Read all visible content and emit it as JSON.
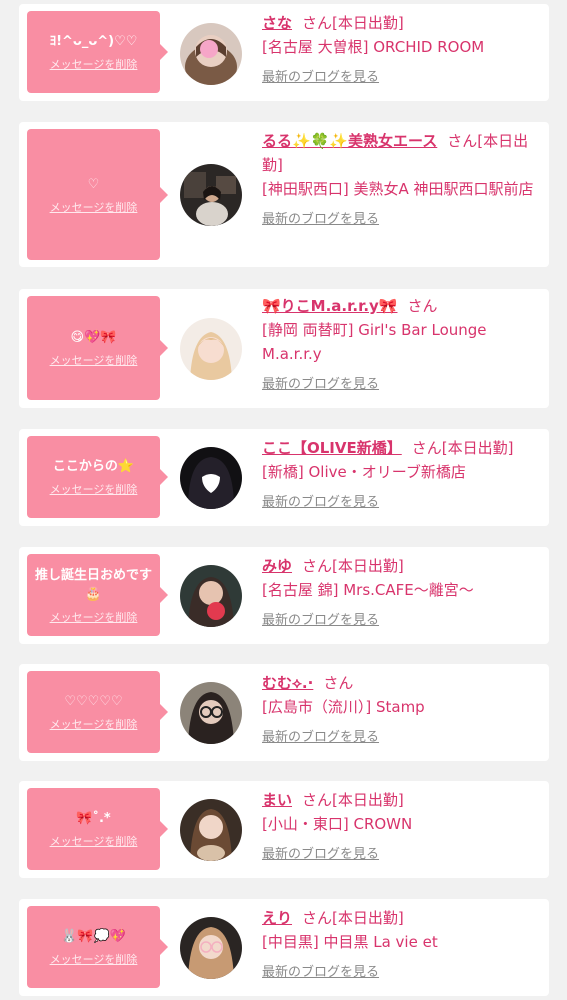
{
  "delete_label": "メッセージを削除",
  "blog_label": "最新のブログを見る",
  "colors": {
    "bubble": "#f98ea3",
    "accent_text": "#d8346c",
    "muted_text": "#8a8a8a",
    "card_bg": "#ffffff",
    "page_bg": "#f1f1f1"
  },
  "entries": [
    {
      "message": "ﾖ!^ᴗ_ᴗ^)♡♡",
      "name": "さな",
      "honorific": "さん",
      "status": "[本日出勤]",
      "shop": "[名古屋 大曽根] ORCHID ROOM",
      "avatar_icon": "photo-avatar"
    },
    {
      "message": "♡",
      "name": "るる✨🍀✨美熟女エース",
      "honorific": "さん",
      "status": "[本日出勤]",
      "shop": "[神田駅西口] 美熟女A 神田駅西口駅前店",
      "avatar_icon": "photo-avatar"
    },
    {
      "message": "😋💖🎀",
      "name": "🎀りこM.a.r.r.y🎀",
      "honorific": "さん",
      "status": "",
      "shop": "[静岡 両替町] Girl's Bar Lounge M.a.r.r.y",
      "avatar_icon": "photo-avatar"
    },
    {
      "message": "ここからの⭐",
      "name": "ここ【OLIVE新橋】",
      "honorific": "さん",
      "status": "[本日出勤]",
      "shop": "[新橋] Olive・オリーブ新橋店",
      "avatar_icon": "photo-avatar"
    },
    {
      "message": "推し誕生日おめです🎂",
      "name": "みゆ",
      "honorific": "さん",
      "status": "[本日出勤]",
      "shop": "[名古屋 錦] Mrs.CAFE〜離宮〜",
      "avatar_icon": "photo-avatar"
    },
    {
      "message": "♡♡♡♡♡",
      "name": "むむ⟡.·",
      "honorific": "さん",
      "status": "",
      "shop": "[広島市（流川）] Stamp",
      "avatar_icon": "photo-avatar"
    },
    {
      "message": "🎀˚.*",
      "name": "まい",
      "honorific": "さん",
      "status": "[本日出勤]",
      "shop": "[小山・東口] CROWN",
      "avatar_icon": "photo-avatar"
    },
    {
      "message": "🐰🎀💭💖",
      "name": "えり",
      "honorific": "さん",
      "status": "[本日出勤]",
      "shop": "[中目黒] 中目黒 La vie et",
      "avatar_icon": "photo-avatar"
    }
  ]
}
